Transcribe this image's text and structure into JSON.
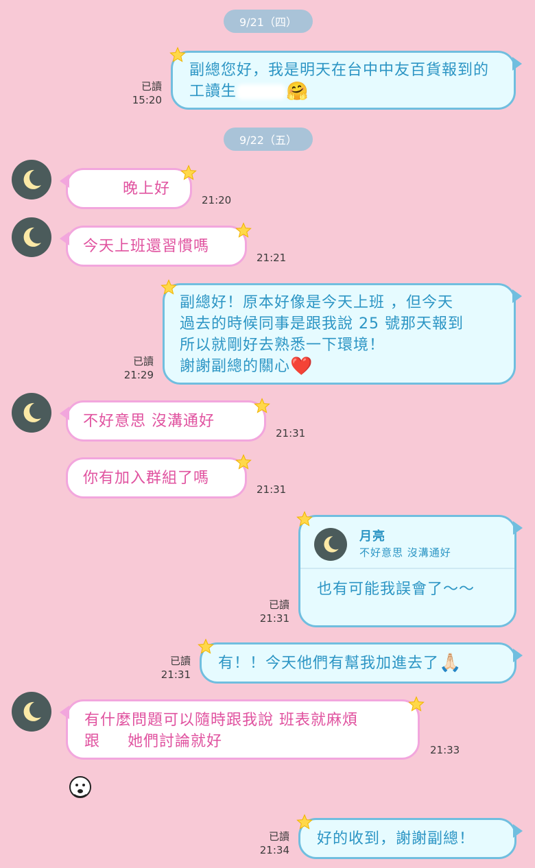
{
  "dates": [
    "9/21（四）",
    "9/22（五）"
  ],
  "messages": {
    "m1": {
      "text": "副總您好，我是明天在台中中友百貨報到的工讀生",
      "emoji": "🤗",
      "read": "已讀",
      "time": "15:20"
    },
    "m2": {
      "text": "晚上好",
      "time": "21:20"
    },
    "m3": {
      "text": "今天上班還習慣嗎",
      "time": "21:21"
    },
    "m4": {
      "lines": [
        "副總好！原本好像是今天上班 ，但今天",
        "過去的時候同事是跟我說 25 號那天報到",
        "所以就剛好去熟悉一下環境！",
        "謝謝副總的關心"
      ],
      "emoji": "❤️",
      "read": "已讀",
      "time": "21:29"
    },
    "m5": {
      "text": "不好意思 沒溝通好",
      "time": "21:31"
    },
    "m6": {
      "text": "你有加入群組了嗎",
      "time": "21:31"
    },
    "m7": {
      "quote_name": "月亮",
      "quote_text": "不好意思 沒溝通好",
      "text": "也有可能我誤會了～～",
      "read": "已讀",
      "time": "21:31"
    },
    "m8": {
      "text": "有！！今天他們有幫我加進去了",
      "emoji": "🙏🏻",
      "read": "已讀",
      "time": "21:31"
    },
    "m9": {
      "line1": "有什麼問題可以隨時跟我說  班表就麻煩",
      "line2_a": "跟",
      "line2_b": "她們討論就好",
      "time": "21:33"
    },
    "m10": {
      "text": "好的收到，謝謝副總！",
      "read": "已讀",
      "time": "21:34"
    }
  },
  "colors": {
    "background": "#f8c9d6",
    "incoming_border": "#f2a6dd",
    "incoming_text": "#e0529f",
    "outgoing_border": "#70bedf",
    "outgoing_text": "#2c95c4",
    "date_pill": "#a9c3d8",
    "star": "#ffd84a"
  },
  "icons": {
    "avatar": "moon-icon",
    "star": "star-icon",
    "sticker": "emoji-sticker-icon"
  }
}
